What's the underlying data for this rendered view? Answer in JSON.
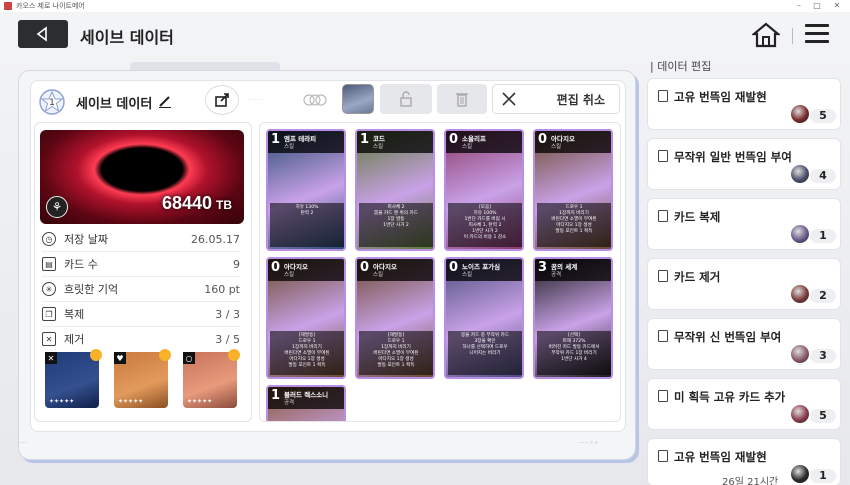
{
  "window": {
    "title": "카오스 제로 나이트메어"
  },
  "header": {
    "title": "세이브 데이터"
  },
  "save": {
    "rank": "1",
    "name": "세이브 데이터",
    "cancel_label": "편집 취소",
    "banner_value": "68440",
    "banner_unit": "TB"
  },
  "stats": [
    {
      "label": "저장 날짜",
      "value": "26.05.17",
      "icon": "clock-icon"
    },
    {
      "label": "카드 수",
      "value": "9",
      "icon": "cards-icon"
    },
    {
      "label": "흐릿한 기억",
      "value": "160 pt",
      "icon": "memory-icon"
    },
    {
      "label": "복제",
      "value": "3 / 3",
      "icon": "copy-icon"
    },
    {
      "label": "제거",
      "value": "3 / 5",
      "icon": "remove-icon"
    }
  ],
  "items": [
    {
      "name": "equipment-1",
      "color": "#1e3a78",
      "corner": "X"
    },
    {
      "name": "equipment-2",
      "color": "#c77a3c",
      "corner": "♥"
    },
    {
      "name": "equipment-3",
      "color": "#c7735a",
      "corner": "○"
    }
  ],
  "cards": [
    {
      "cost": "1",
      "name": "엠프 테라피",
      "type": "스킬",
      "desc": "치유 130%\n탄력 2",
      "color": "#2b4c73"
    },
    {
      "cost": "1",
      "name": "코드",
      "type": "스킬",
      "desc": "피사체 2\n뽑을 카드 맨 위의 카드\n1장 발동\n1번단 사거 2",
      "color": "#5f7a3b"
    },
    {
      "cost": "0",
      "name": "소울리프",
      "type": "스킬",
      "desc": "[모음]\n치유 100%\n1번단 카드를 버림 시\n피사체 1, 탄력 2\n1번단 사거 2\n이 카드의 비용 1 감소",
      "color": "#8b3b6b"
    },
    {
      "cost": "0",
      "name": "아다지오",
      "type": "스킬",
      "desc": "드로우 1\n1장까지 버리기\n버린다면 소멸이 부여된\n아다지오 1장 생성\n발동 포인트 1 획득",
      "color": "#6b4a2e"
    },
    {
      "cost": "0",
      "name": "아다지오",
      "type": "스킬",
      "desc": "[재발동]\n드로우 1\n1장까지 버리기\n버린다면 소멸이 부여된\n아다지오 1장 생성\n발동 포인트 1 획득",
      "color": "#6b4a2e"
    },
    {
      "cost": "0",
      "name": "아다지오",
      "type": "스킬",
      "desc": "[재발동]\n드로우 1\n1장까지 버리기\n버린다면 소멸이 부여된\n아다지오 1장 생성\n발동 포인트 1 획득",
      "color": "#6b4a2e"
    },
    {
      "cost": "0",
      "name": "노이즈 포가심",
      "type": "스킬",
      "desc": "봉을 카드 중 무작위 카드\n3장을 확인\n하나를 선택하여 드로우\n나머지는 버리기",
      "color": "#4a4c7a"
    },
    {
      "cost": "3",
      "name": "꿈의 세계",
      "type": "공격",
      "desc": "[선택]\n피해 372%\n버려진 카드 발동 카드에서\n무작위 카드 1장 버리기\n1번단 사거 4",
      "color": "#1a1a1a"
    },
    {
      "cost": "1",
      "name": "블러드 렉스소니",
      "type": "공격",
      "desc": "",
      "color": "#8a5a3a"
    }
  ],
  "sidebar": {
    "title": "데이터 편집",
    "items": [
      {
        "label": "고유 번뜩임 재발현",
        "count": "5",
        "time": "",
        "avatar": "#7a2a2a"
      },
      {
        "label": "무작위 일반 번뜩임 부여",
        "count": "4",
        "time": "",
        "avatar": "#4a4e6a"
      },
      {
        "label": "카드 복제",
        "count": "1",
        "time": "",
        "avatar": "#6a5a8a"
      },
      {
        "label": "카드 제거",
        "count": "2",
        "time": "",
        "avatar": "#7a3a3a"
      },
      {
        "label": "무작위 신 번뜩임 부여",
        "count": "3",
        "time": "",
        "avatar": "#8a5a6a"
      },
      {
        "label": "미 획득 고유 카드 추가",
        "count": "5",
        "time": "",
        "avatar": "#8a3a4a"
      },
      {
        "label": "고유 번뜩임 재발현",
        "count": "1",
        "time": "26일 21시간",
        "avatar": "#2a2a2a"
      }
    ]
  }
}
